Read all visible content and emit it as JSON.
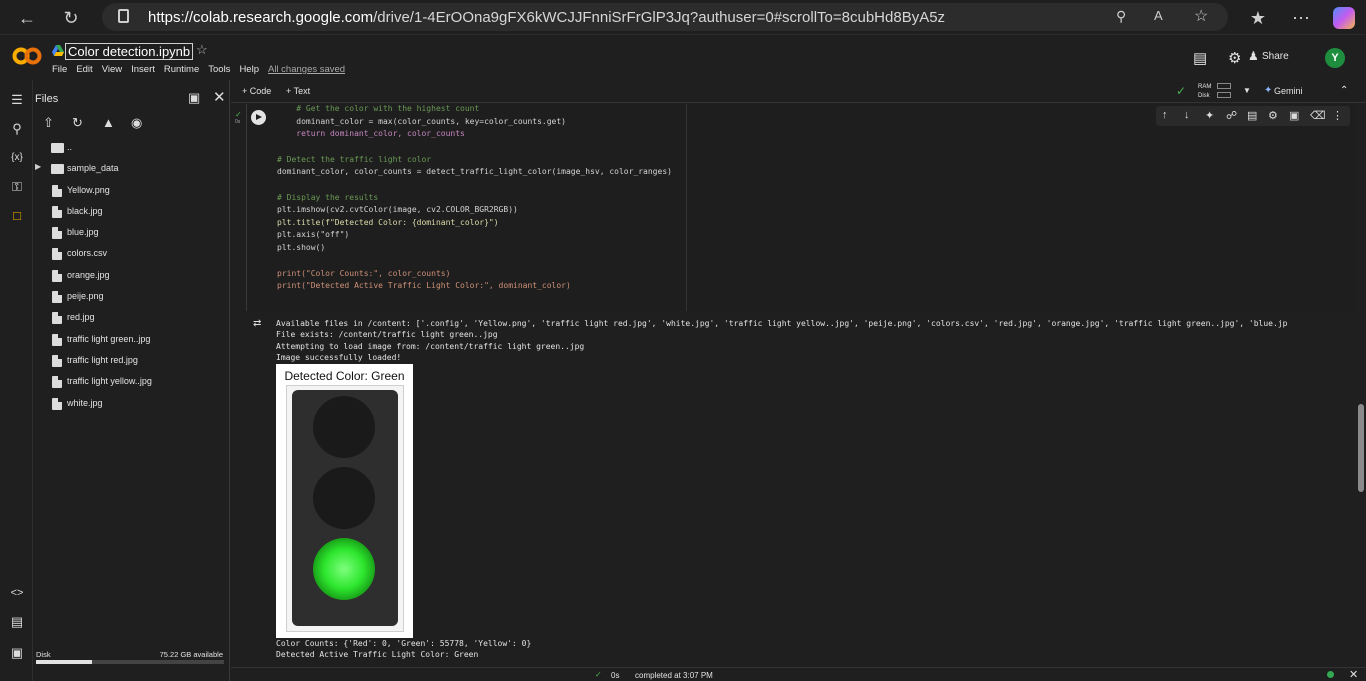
{
  "browser": {
    "url_host": "https://colab.research.google.com",
    "url_path": "/drive/1-4ErOOna9gFX6kWCJJFnniSrFrGlP3Jq?authuser=0#scrollTo=8cubHd8ByA5z"
  },
  "header": {
    "title": "Color detection.ipynb",
    "menu": [
      "File",
      "Edit",
      "View",
      "Insert",
      "Runtime",
      "Tools",
      "Help"
    ],
    "saved_status": "All changes saved",
    "share_label": "Share",
    "avatar_letter": "Y"
  },
  "toolbar": {
    "code_label": "+ Code",
    "text_label": "+ Text",
    "ram_label": "RAM",
    "disk_label": "Disk",
    "gemini_label": "Gemini"
  },
  "files": {
    "title": "Files",
    "items": [
      {
        "name": "..",
        "type": "folder-up"
      },
      {
        "name": "sample_data",
        "type": "folder"
      },
      {
        "name": "Yellow.png",
        "type": "file"
      },
      {
        "name": "black.jpg",
        "type": "file"
      },
      {
        "name": "blue.jpg",
        "type": "file"
      },
      {
        "name": "colors.csv",
        "type": "file"
      },
      {
        "name": "orange.jpg",
        "type": "file"
      },
      {
        "name": "peije.png",
        "type": "file"
      },
      {
        "name": "red.jpg",
        "type": "file"
      },
      {
        "name": "traffic light green..jpg",
        "type": "file"
      },
      {
        "name": "traffic light red.jpg",
        "type": "file"
      },
      {
        "name": "traffic light yellow..jpg",
        "type": "file"
      },
      {
        "name": "white.jpg",
        "type": "file"
      }
    ],
    "disk_label": "Disk",
    "disk_available": "75.22 GB available",
    "disk_used_fraction": 0.3
  },
  "cell": {
    "exec_time": "0s",
    "code_lines": [
      "    # Get the color with the highest count",
      "    dominant_color = max(color_counts, key=color_counts.get)",
      "    return dominant_color, color_counts",
      "",
      "# Detect the traffic light color",
      "dominant_color, color_counts = detect_traffic_light_color(image_hsv, color_ranges)",
      "",
      "# Display the results",
      "plt.imshow(cv2.cvtColor(image, cv2.COLOR_BGR2RGB))",
      "plt.title(f\"Detected Color: {dominant_color}\")",
      "plt.axis(\"off\")",
      "plt.show()",
      "",
      "print(\"Color Counts:\", color_counts)",
      "print(\"Detected Active Traffic Light Color:\", dominant_color)"
    ]
  },
  "output": {
    "line1": "Available files in /content: ['.config', 'Yellow.png', 'traffic light red.jpg', 'white.jpg', 'traffic light yellow..jpg', 'peije.png', 'colors.csv', 'red.jpg', 'orange.jpg', 'traffic light green..jpg', 'blue.jp",
    "line2": "File exists: /content/traffic light green..jpg",
    "line3": "Attempting to load image from: /content/traffic light green..jpg",
    "line4": "Image successfully loaded!",
    "figure_title": "Detected Color: Green",
    "line5": "Color Counts: {'Red': 0, 'Green': 55778, 'Yellow': 0}",
    "line6": "Detected Active Traffic Light Color: Green"
  },
  "status": {
    "time": "0s",
    "completed": "completed at 3:07 PM"
  }
}
